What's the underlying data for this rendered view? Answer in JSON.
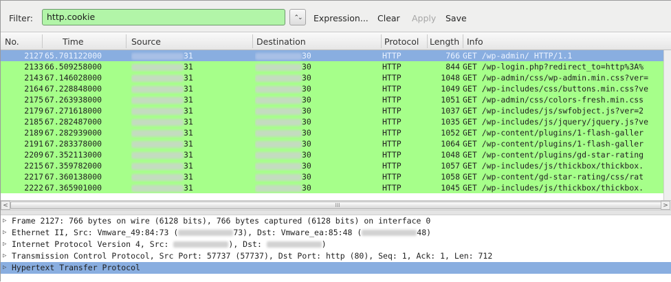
{
  "filter": {
    "label": "Filter:",
    "value": "http.cookie",
    "dropdown_glyph": "⌃⌄",
    "expression": "Expression...",
    "clear": "Clear",
    "apply": "Apply",
    "save": "Save"
  },
  "columns": {
    "no": "No.",
    "time": "Time",
    "source": "Source",
    "destination": "Destination",
    "protocol": "Protocol",
    "length": "Length",
    "info": "Info"
  },
  "packets": [
    {
      "no": "2127",
      "time": "65.701122000",
      "src": "31",
      "dst": "30",
      "proto": "HTTP",
      "len": "766",
      "info": "GET /wp-admin/ HTTP/1.1"
    },
    {
      "no": "2133",
      "time": "66.509258000",
      "src": "31",
      "dst": "30",
      "proto": "HTTP",
      "len": "844",
      "info": "GET /wp-login.php?redirect_to=http%3A%"
    },
    {
      "no": "2143",
      "time": "67.146028000",
      "src": "31",
      "dst": "30",
      "proto": "HTTP",
      "len": "1048",
      "info": "GET /wp-admin/css/wp-admin.min.css?ver="
    },
    {
      "no": "2164",
      "time": "67.228848000",
      "src": "31",
      "dst": "30",
      "proto": "HTTP",
      "len": "1049",
      "info": "GET /wp-includes/css/buttons.min.css?ve"
    },
    {
      "no": "2175",
      "time": "67.263938000",
      "src": "31",
      "dst": "30",
      "proto": "HTTP",
      "len": "1051",
      "info": "GET /wp-admin/css/colors-fresh.min.css"
    },
    {
      "no": "2179",
      "time": "67.271618000",
      "src": "31",
      "dst": "30",
      "proto": "HTTP",
      "len": "1037",
      "info": "GET /wp-includes/js/swfobject.js?ver=2"
    },
    {
      "no": "2185",
      "time": "67.282487000",
      "src": "31",
      "dst": "30",
      "proto": "HTTP",
      "len": "1035",
      "info": "GET /wp-includes/js/jquery/jquery.js?ve"
    },
    {
      "no": "2189",
      "time": "67.282939000",
      "src": "31",
      "dst": "30",
      "proto": "HTTP",
      "len": "1052",
      "info": "GET /wp-content/plugins/1-flash-galler"
    },
    {
      "no": "2191",
      "time": "67.283378000",
      "src": "31",
      "dst": "30",
      "proto": "HTTP",
      "len": "1064",
      "info": "GET /wp-content/plugins/1-flash-galler"
    },
    {
      "no": "2209",
      "time": "67.352113000",
      "src": "31",
      "dst": "30",
      "proto": "HTTP",
      "len": "1048",
      "info": "GET /wp-content/plugins/gd-star-rating"
    },
    {
      "no": "2215",
      "time": "67.359782000",
      "src": "31",
      "dst": "30",
      "proto": "HTTP",
      "len": "1057",
      "info": "GET /wp-includes/js/thickbox/thickbox."
    },
    {
      "no": "2217",
      "time": "67.360138000",
      "src": "31",
      "dst": "30",
      "proto": "HTTP",
      "len": "1058",
      "info": "GET /wp-content/gd-star-rating/css/rat"
    },
    {
      "no": "2222",
      "time": "67.365901000",
      "src": "31",
      "dst": "30",
      "proto": "HTTP",
      "len": "1045",
      "info": "GET /wp-includes/js/thickbox/thickbox."
    }
  ],
  "scrollbar": {
    "left_arrow": "<",
    "right_arrow": ">",
    "thumb_grip": "III"
  },
  "details": [
    {
      "pre": "Frame 2127: 766 bytes on wire (6128 bits), 766 bytes captured (6128 bits) on interface 0",
      "post": ""
    },
    {
      "pre": "Ethernet II, Src: Vmware_49:84:73 (",
      "post": "73), Dst: Vmware_ea:85:48 (",
      "post2": "48)"
    },
    {
      "pre": "Internet Protocol Version 4, Src: ",
      "post": "), Dst: ",
      "post2": ")"
    },
    {
      "pre": "Transmission Control Protocol, Src Port: 57737 (57737), Dst Port: http (80), Seq: 1, Ack: 1, Len: 712",
      "post": ""
    },
    {
      "pre": "Hypertext Transfer Protocol",
      "post": ""
    }
  ],
  "colors": {
    "row_green": "#a6ff8a",
    "row_selected": "#89aee0",
    "filter_ok": "#b2f5a8"
  },
  "icons": {
    "expand": "triangle-right-icon"
  }
}
